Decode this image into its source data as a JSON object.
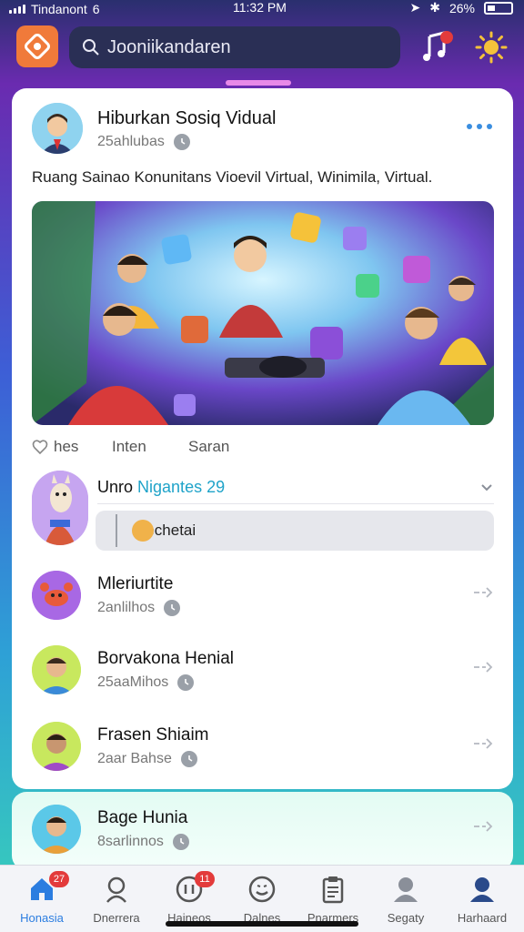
{
  "status_bar": {
    "carrier": "Tindanont",
    "network": "6",
    "time": "11:32 PM",
    "battery": "26%"
  },
  "header": {
    "search_text": "Jooniikandaren",
    "music_badge": "1"
  },
  "post": {
    "author": "Hiburkan Sosiq Vidual",
    "meta": "25ahlubas",
    "text": "Ruang  Sainao Konunitans Vioevil Virtual, Winimila, Virtual.",
    "image_icon_name": "community-party-illustration",
    "actions": [
      "hes",
      "Inten",
      "Saran"
    ]
  },
  "group": {
    "title_prefix": "Unro",
    "title_highlight": "Nigantes 29",
    "reply_text": "Sechetai"
  },
  "list": [
    {
      "name": "Mleriurtite",
      "meta": "2anlilhos",
      "avatar_color": "#a868e4"
    },
    {
      "name": "Borvakona Henial",
      "meta": "25aaMihos",
      "avatar_color": "#c8e85e"
    },
    {
      "name": "Frasen Shiaim",
      "meta": "2aar Bahse",
      "avatar_color": "#c8e85e"
    },
    {
      "name": "Bage Hunia",
      "meta": "8sarlinnos",
      "avatar_color": "#5bc8e8"
    }
  ],
  "tabs": [
    {
      "label": "Honasia",
      "badge": "27"
    },
    {
      "label": "Dnerrera",
      "badge": ""
    },
    {
      "label": "Haineos",
      "badge": "11"
    },
    {
      "label": "Dalnes",
      "badge": ""
    },
    {
      "label": "Pnarmers",
      "badge": ""
    },
    {
      "label": "Segaty",
      "badge": ""
    },
    {
      "label": "Harhaard",
      "badge": ""
    }
  ],
  "colors": {
    "accent": "#2b7de0",
    "logo": "#f07a3a",
    "badge": "#e33b3b",
    "highlight": "#1fa3c9"
  }
}
